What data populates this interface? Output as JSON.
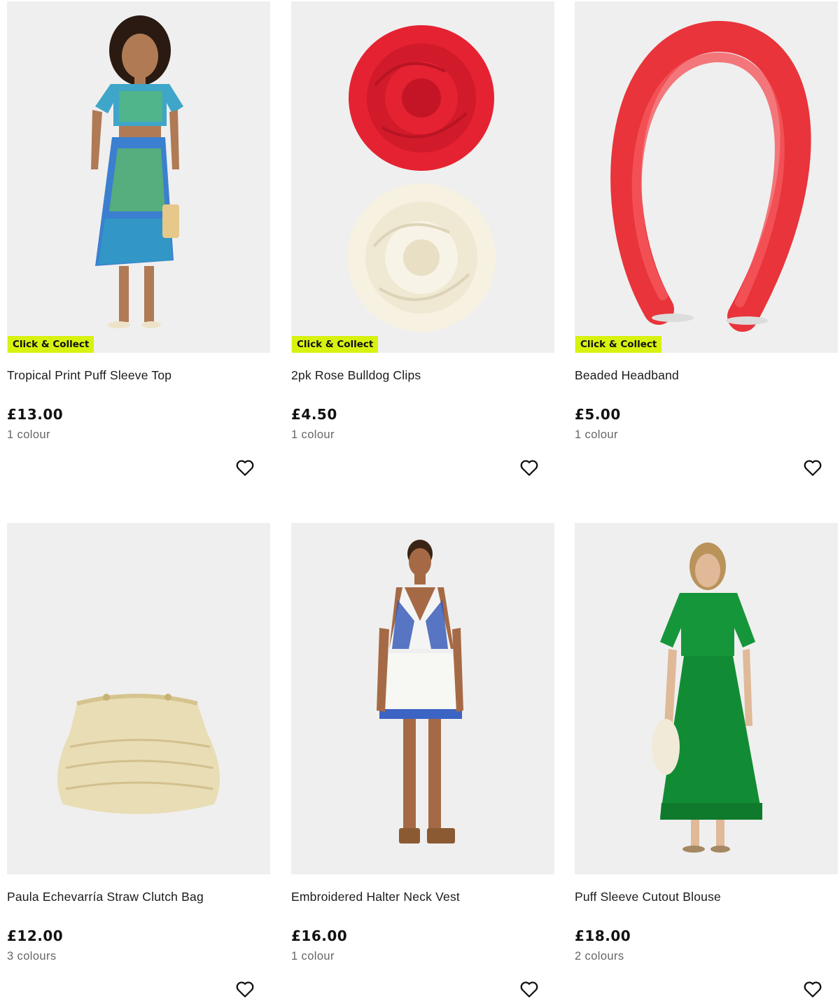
{
  "products": [
    {
      "title": "Tropical Print Puff Sleeve Top",
      "price": "£13.00",
      "colours": "1 colour",
      "badge": "Click & Collect",
      "image": "model-tropical-print-outfit"
    },
    {
      "title": "2pk Rose Bulldog Clips",
      "price": "£4.50",
      "colours": "1 colour",
      "badge": "Click & Collect",
      "image": "red-and-white-rose-clips"
    },
    {
      "title": "Beaded Headband",
      "price": "£5.00",
      "colours": "1 colour",
      "badge": "Click & Collect",
      "image": "red-beaded-headband"
    },
    {
      "title": "Paula Echevarría Straw Clutch Bag",
      "price": "£12.00",
      "colours": "3 colours",
      "badge": "",
      "image": "straw-clutch-bag"
    },
    {
      "title": "Embroidered Halter Neck Vest",
      "price": "£16.00",
      "colours": "1 colour",
      "badge": "",
      "image": "model-blue-white-halter-vest"
    },
    {
      "title": "Puff Sleeve Cutout Blouse",
      "price": "£18.00",
      "colours": "2 colours",
      "badge": "",
      "image": "model-green-puff-sleeve-blouse"
    }
  ],
  "icons": {
    "wishlist": "heart-outline-icon"
  },
  "colors": {
    "badge_bg": "#d7f20f",
    "image_bg": "#efefef",
    "muted_text": "#666666"
  }
}
